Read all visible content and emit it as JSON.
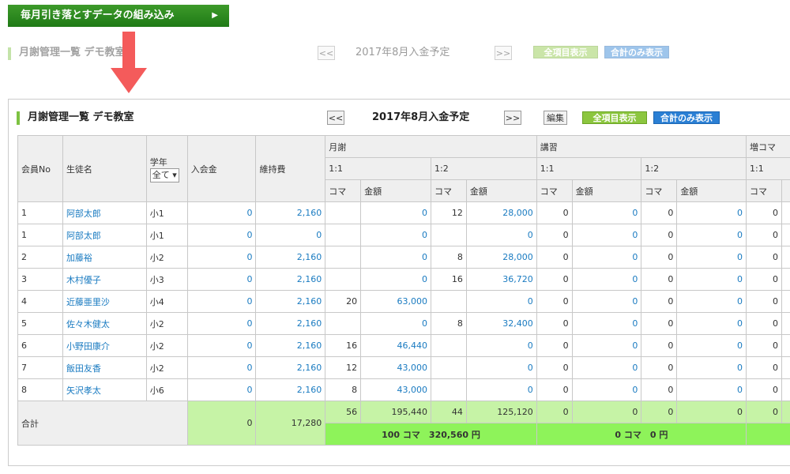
{
  "banner": {
    "label": "毎月引き落とすデータの組み込み"
  },
  "header": {
    "title": "月謝管理一覧 デモ教室",
    "prev": "<<",
    "next": ">>",
    "month": "2017年8月入金予定",
    "edit": "編集",
    "show_all": "全項目表示",
    "show_total": "合計のみ表示"
  },
  "table": {
    "headers": {
      "member_no": "会員No",
      "student": "生徒名",
      "grade": "学年",
      "grade_select": "全て",
      "admission": "入会金",
      "maintenance": "維持費",
      "monthly": "月謝",
      "course": "講習",
      "extra": "増コマ",
      "one_one": "1:1",
      "one_two": "1:2",
      "koma": "コマ",
      "amount": "金額"
    },
    "rows": [
      {
        "no": "1",
        "name": "阿部太郎",
        "grade": "小1",
        "adm": "0",
        "maint": "2,160",
        "m11k": "",
        "m11a": "0",
        "m12k": "12",
        "m12a": "28,000",
        "c11k": "0",
        "c11a": "0",
        "c12k": "0",
        "c12a": "0",
        "e11k": "0"
      },
      {
        "no": "1",
        "name": "阿部太郎",
        "grade": "小1",
        "adm": "0",
        "maint": "0",
        "m11k": "",
        "m11a": "0",
        "m12k": "",
        "m12a": "0",
        "c11k": "0",
        "c11a": "0",
        "c12k": "0",
        "c12a": "0",
        "e11k": "0"
      },
      {
        "no": "2",
        "name": "加藤裕",
        "grade": "小2",
        "adm": "0",
        "maint": "2,160",
        "m11k": "",
        "m11a": "0",
        "m12k": "8",
        "m12a": "28,000",
        "c11k": "0",
        "c11a": "0",
        "c12k": "0",
        "c12a": "0",
        "e11k": "0"
      },
      {
        "no": "3",
        "name": "木村優子",
        "grade": "小3",
        "adm": "0",
        "maint": "2,160",
        "m11k": "",
        "m11a": "0",
        "m12k": "16",
        "m12a": "36,720",
        "c11k": "0",
        "c11a": "0",
        "c12k": "0",
        "c12a": "0",
        "e11k": "0"
      },
      {
        "no": "4",
        "name": "近藤亜里沙",
        "grade": "小4",
        "adm": "0",
        "maint": "2,160",
        "m11k": "20",
        "m11a": "63,000",
        "m12k": "",
        "m12a": "0",
        "c11k": "0",
        "c11a": "0",
        "c12k": "0",
        "c12a": "0",
        "e11k": "0"
      },
      {
        "no": "5",
        "name": "佐々木健太",
        "grade": "小2",
        "adm": "0",
        "maint": "2,160",
        "m11k": "",
        "m11a": "0",
        "m12k": "8",
        "m12a": "32,400",
        "c11k": "0",
        "c11a": "0",
        "c12k": "0",
        "c12a": "0",
        "e11k": "0"
      },
      {
        "no": "6",
        "name": "小野田康介",
        "grade": "小2",
        "adm": "0",
        "maint": "2,160",
        "m11k": "16",
        "m11a": "46,440",
        "m12k": "",
        "m12a": "0",
        "c11k": "0",
        "c11a": "0",
        "c12k": "0",
        "c12a": "0",
        "e11k": "0"
      },
      {
        "no": "7",
        "name": "飯田友香",
        "grade": "小2",
        "adm": "0",
        "maint": "2,160",
        "m11k": "12",
        "m11a": "43,000",
        "m12k": "",
        "m12a": "0",
        "c11k": "0",
        "c11a": "0",
        "c12k": "0",
        "c12a": "0",
        "e11k": "0"
      },
      {
        "no": "8",
        "name": "矢沢孝太",
        "grade": "小6",
        "adm": "0",
        "maint": "2,160",
        "m11k": "8",
        "m11a": "43,000",
        "m12k": "",
        "m12a": "0",
        "c11k": "0",
        "c11a": "0",
        "c12k": "0",
        "c12a": "0",
        "e11k": "0"
      }
    ],
    "total": {
      "label": "合計",
      "adm": "0",
      "maint": "17,280",
      "m11k": "56",
      "m11a": "195,440",
      "m12k": "44",
      "m12a": "125,120",
      "c11k": "0",
      "c11a": "0",
      "c12k": "0",
      "c12a": "0",
      "e11k": "0",
      "monthly_sum": "100 コマ　320,560 円",
      "course_sum": "0 コマ　0 円"
    }
  }
}
